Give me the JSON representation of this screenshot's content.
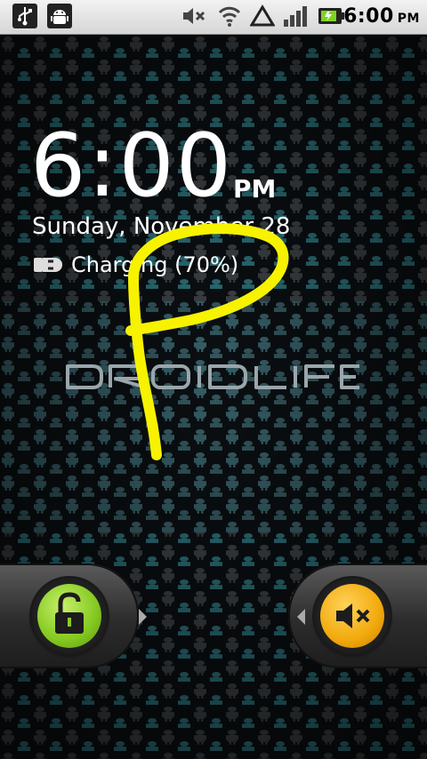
{
  "status_bar": {
    "icons_left": [
      "usb-icon",
      "android-debug-icon"
    ],
    "icons_right": [
      "silent-icon",
      "wifi-icon",
      "data-roaming-icon",
      "signal-icon",
      "battery-charging-icon"
    ],
    "time": "6:00",
    "ampm": "PM"
  },
  "lockscreen": {
    "time": "6:00",
    "ampm": "PM",
    "date": "Sunday, November 28",
    "charging": "Charging (70%)",
    "logo_text": "DROIDLIFE"
  },
  "tabs": {
    "unlock_icon": "unlock-icon",
    "sound_icon": "sound-off-icon"
  },
  "colors": {
    "scribble": "#f7f200",
    "unlock": "#8bc926",
    "sound": "#f2a90c",
    "wallpaper_teal": "#2a7f8a"
  }
}
